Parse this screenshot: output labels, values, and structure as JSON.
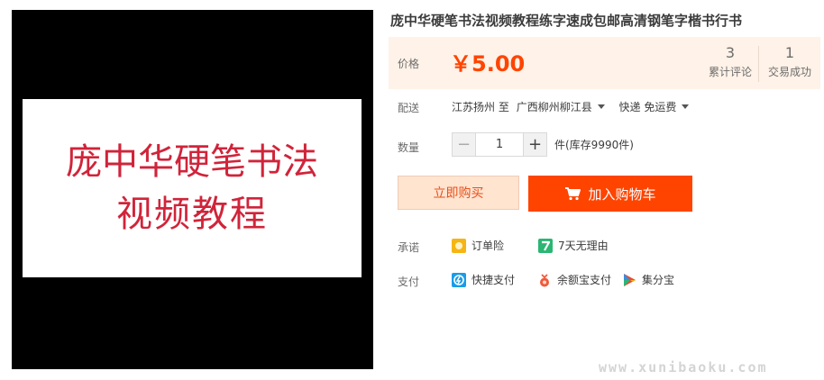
{
  "gallery": {
    "image_line1": "庞中华硬笔书法",
    "image_line2": "视频教程"
  },
  "product": {
    "title": "庞中华硬笔书法视频教程练字速成包邮高清钢笔字楷书行书",
    "price_label": "价格",
    "price": "￥5.00",
    "review_count": "3",
    "review_label": "累计评论",
    "deal_count": "1",
    "deal_label": "交易成功"
  },
  "shipping": {
    "label": "配送",
    "origin": "江苏扬州",
    "to": "至",
    "destination": "广西柳州柳江县",
    "method": "快递 免运费"
  },
  "quantity": {
    "label": "数量",
    "minus": "−",
    "value": "1",
    "plus": "+",
    "stock": "件(库存9990件)"
  },
  "actions": {
    "buy_now": "立即购买",
    "add_to_cart": "加入购物车"
  },
  "promise": {
    "label": "承诺",
    "items": [
      "订单险",
      "7天无理由"
    ]
  },
  "payment": {
    "label": "支付",
    "items": [
      "快捷支付",
      "余额宝支付",
      "集分宝"
    ]
  },
  "watermark": "www.xunibaoku.com",
  "colors": {
    "accent": "#ff4400",
    "price_panel_bg": "#fff2e8",
    "buy_now_bg": "#ffe4d0",
    "image_text": "#d0243a"
  }
}
